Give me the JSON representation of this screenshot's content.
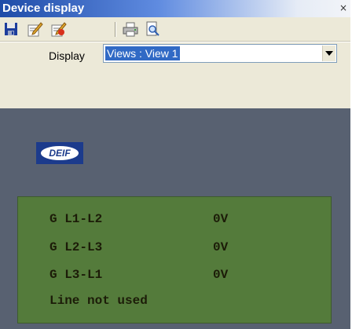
{
  "window": {
    "title": "Device display",
    "close_glyph": "×"
  },
  "toolbar": {
    "buttons": [
      {
        "name": "save-icon"
      },
      {
        "name": "edit-icon"
      },
      {
        "name": "edit-alt-icon"
      },
      {
        "name": "print-icon"
      },
      {
        "name": "print-preview-icon"
      }
    ]
  },
  "display": {
    "label": "Display",
    "selected": "Views : View 1"
  },
  "device": {
    "logo_text": "DEIF",
    "lcd_lines": [
      {
        "label": "G L1-L2",
        "value": "0V"
      },
      {
        "label": "G L2-L3",
        "value": "0V"
      },
      {
        "label": "G L3-L1",
        "value": "0V"
      },
      {
        "label": "Line not used",
        "value": ""
      }
    ]
  },
  "colors": {
    "title_bar": "#1f4ca8",
    "panel": "#ece9d8",
    "device_bg": "#586171",
    "lcd_bg": "#547b3b",
    "lcd_text": "#1c1c08",
    "logo_bg": "#1c3b8c"
  }
}
